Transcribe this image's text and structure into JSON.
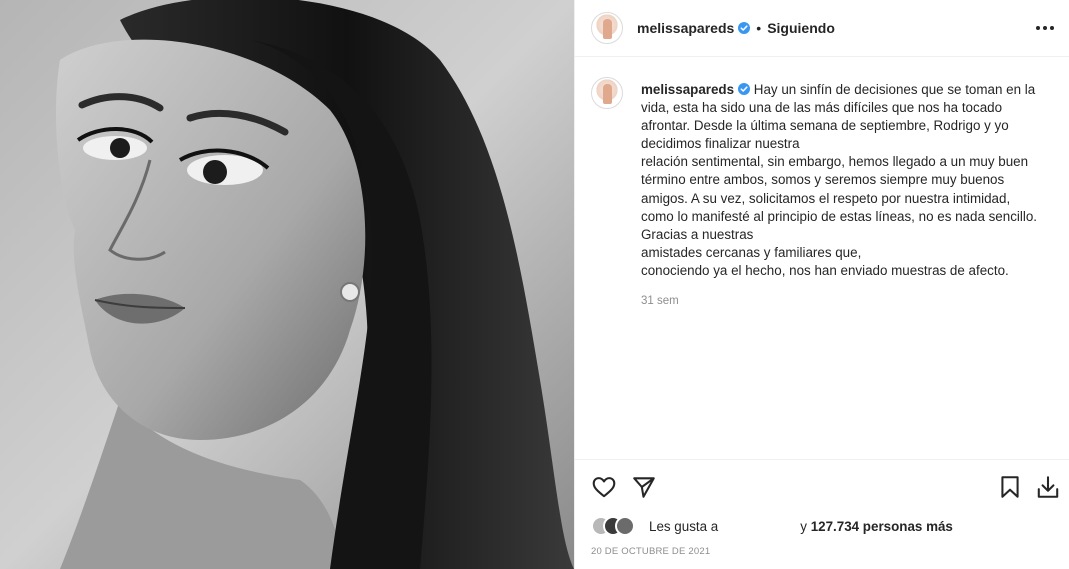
{
  "post": {
    "username": "melissapareds",
    "separator": "•",
    "follow_status": "Siguiendo",
    "caption_lines": [
      "Hay un sinfín de decisiones que se toman en la",
      "vida, esta ha sido una de las más difíciles que nos ha tocado",
      "afrontar. Desde la última semana de septiembre, Rodrigo y yo",
      "decidimos finalizar nuestra",
      "relación sentimental, sin embargo, hemos llegado a un muy buen",
      "término entre ambos, somos y seremos siempre muy buenos",
      "amigos. A su vez, solicitamos el respeto por nuestra intimidad,",
      "como lo manifesté al principio de estas líneas, no es nada sencillo.",
      "Gracias a nuestras",
      "amistades cercanas y familiares que,",
      "conociendo ya el hecho, nos han enviado muestras de afecto."
    ],
    "time_ago": "31 sem",
    "likes_prefix": "Les gusta a",
    "likes_suffix_pre": "y",
    "likes_count": "127.734 personas más",
    "date": "20 DE OCTUBRE DE 2021"
  },
  "icons": {
    "like": "heart-icon",
    "share": "send-icon",
    "save": "bookmark-icon",
    "download": "download-icon",
    "more": "more-options-icon",
    "verified": "verified-badge-icon"
  },
  "colors": {
    "verified_blue": "#3897f0",
    "text": "#262626",
    "muted": "#8e8e8e",
    "border": "#efefef"
  }
}
